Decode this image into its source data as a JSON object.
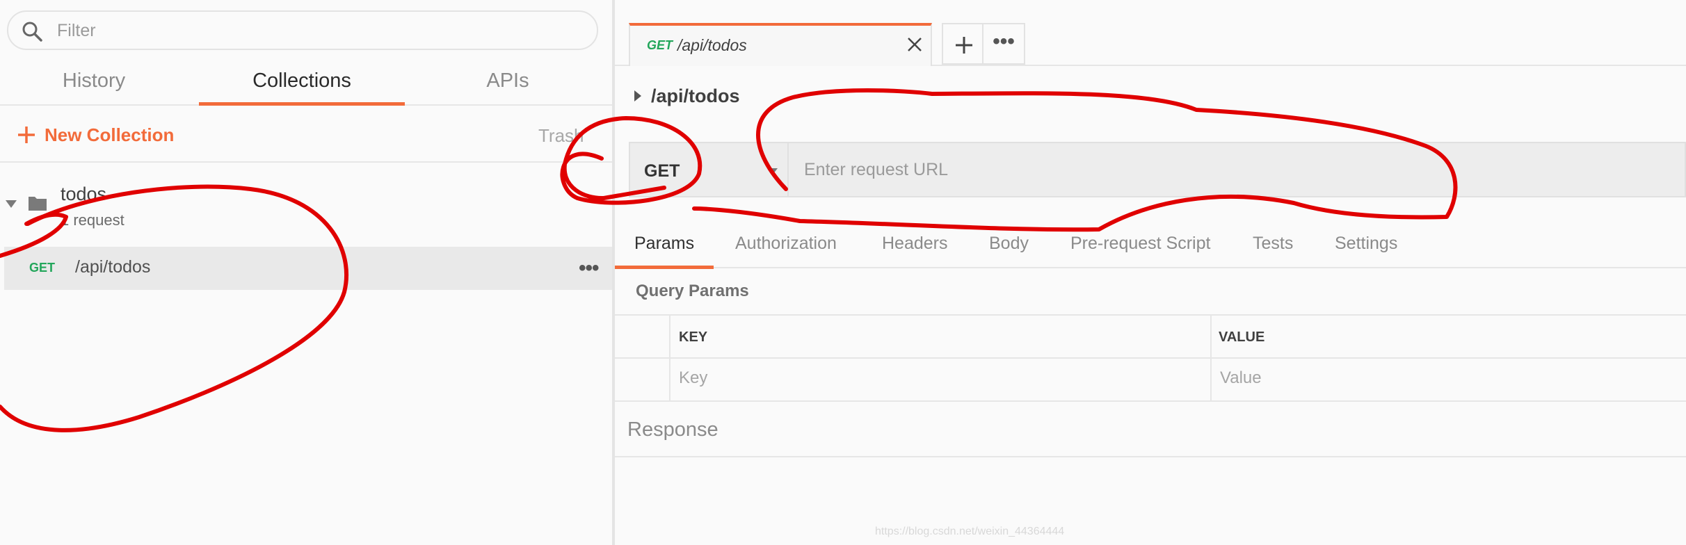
{
  "sidebar": {
    "search_placeholder": "Filter",
    "tabs": [
      {
        "label": "History"
      },
      {
        "label": "Collections"
      },
      {
        "label": "APIs"
      }
    ],
    "new_collection_label": "New Collection",
    "trash_label": "Trash",
    "collection": {
      "name": "todos",
      "subtitle": "1 request",
      "requests": [
        {
          "method": "GET",
          "name": "/api/todos"
        }
      ]
    }
  },
  "main": {
    "open_tab": {
      "method": "GET",
      "name": "/api/todos"
    },
    "breadcrumb": "/api/todos",
    "method": "GET",
    "url_placeholder": "Enter request URL",
    "request_tabs": [
      "Params",
      "Authorization",
      "Headers",
      "Body",
      "Pre-request Script",
      "Tests",
      "Settings"
    ],
    "query_params": {
      "title": "Query Params",
      "columns": [
        "KEY",
        "VALUE"
      ],
      "placeholders": [
        "Key",
        "Value"
      ]
    },
    "response_label": "Response"
  },
  "watermark": "https://blog.csdn.net/weixin_44364444",
  "colors": {
    "accent": "#f26b3a",
    "get_method": "#23a65b",
    "annotation": "#e00000"
  }
}
